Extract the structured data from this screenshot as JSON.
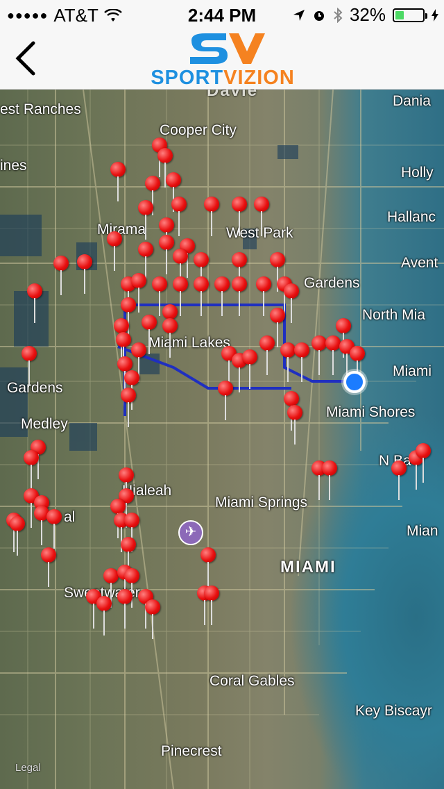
{
  "status_bar": {
    "carrier": "AT&T",
    "time": "2:44 PM",
    "battery": "32%",
    "battery_level": 0.32
  },
  "navbar": {
    "logo_text_a": "SPORT",
    "logo_text_b": "VIZION",
    "logo_initials": "SV"
  },
  "map": {
    "labels": {
      "west_ranches": "est Ranches",
      "dania": "Dania",
      "cooper_city": "Cooper City",
      "ines": "ines",
      "holly": "Holly",
      "halland": "Hallanc",
      "west_park": "West Park",
      "mirama": "Mirama",
      "avent": "Avent",
      "gardens_top": "Gardens",
      "north_mia": "North Mia",
      "miami_lakes": "Miami Lakes",
      "miami_right": "Miami",
      "gardens_left": "Gardens",
      "medley": "Medley",
      "miami_shores": "Miami Shores",
      "nb": "N Ba",
      "hialeah": "Hialeah",
      "miami_springs": "Miami Springs",
      "al": "al",
      "mian": "Mian",
      "miami_big": "MIAMI",
      "sweetwater": "Sweetwater",
      "coral_gables": "Coral Gables",
      "key_biscayne": "Key Biscayr",
      "pinecrest": "Pinecrest",
      "legal": "Legal",
      "davie": "Davie"
    }
  }
}
